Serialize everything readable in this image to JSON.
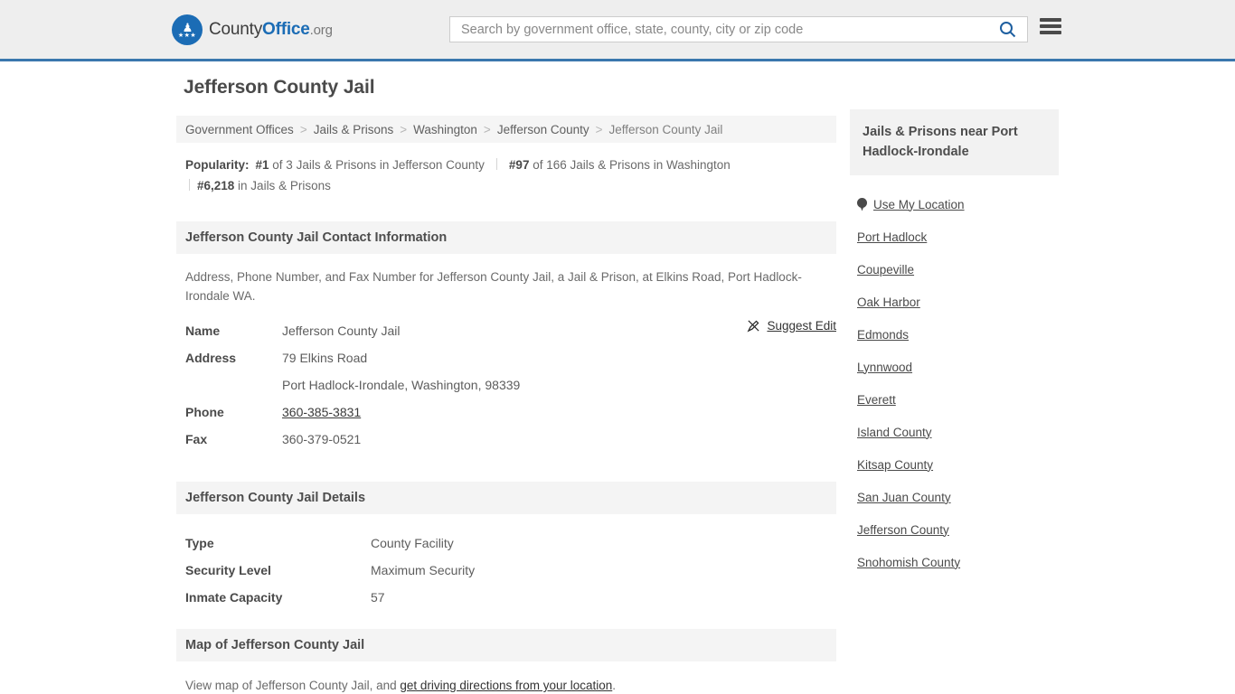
{
  "header": {
    "logo_text_county": "County",
    "logo_text_office": "Office",
    "logo_text_org": ".org",
    "search_placeholder": "Search by government office, state, county, city or zip code",
    "search_value": "",
    "accent_color": "#3a77ad",
    "logo_color": "#1b6cb5"
  },
  "page": {
    "title": "Jefferson County Jail"
  },
  "breadcrumb": {
    "items": [
      {
        "label": "Government Offices"
      },
      {
        "label": "Jails & Prisons"
      },
      {
        "label": "Washington"
      },
      {
        "label": "Jefferson County"
      },
      {
        "label": "Jefferson County Jail"
      }
    ],
    "separator": ">"
  },
  "popularity": {
    "label": "Popularity:",
    "items": [
      {
        "rank": "#1",
        "rest": " of 3 Jails & Prisons in Jefferson County"
      },
      {
        "rank": "#97",
        "rest": " of 166 Jails & Prisons in Washington"
      },
      {
        "rank": "#6,218",
        "rest": " in Jails & Prisons"
      }
    ]
  },
  "contact": {
    "section_title": "Jefferson County Jail Contact Information",
    "description": "Address, Phone Number, and Fax Number for Jefferson County Jail, a Jail & Prison, at Elkins Road, Port Hadlock-Irondale WA.",
    "suggest_edit_label": "Suggest Edit",
    "rows": [
      {
        "key": "Name",
        "value": "Jefferson County Jail"
      },
      {
        "key": "Address",
        "value": "79 Elkins Road"
      },
      {
        "key": "",
        "value": "Port Hadlock-Irondale, Washington, 98339"
      },
      {
        "key": "Phone",
        "value": "360-385-3831"
      },
      {
        "key": "Fax",
        "value": "360-379-0521"
      }
    ]
  },
  "details": {
    "section_title": "Jefferson County Jail Details",
    "rows": [
      {
        "key": "Type",
        "value": "County Facility"
      },
      {
        "key": "Security Level",
        "value": "Maximum Security"
      },
      {
        "key": "Inmate Capacity",
        "value": "57"
      }
    ]
  },
  "map": {
    "section_title": "Map of Jefferson County Jail",
    "desc_prefix": "View map of Jefferson County Jail, and ",
    "link_label": "get driving directions from your location",
    "desc_suffix": "."
  },
  "sidebar": {
    "heading": "Jails & Prisons near Port Hadlock-Irondale",
    "use_my_location": "Use My Location",
    "links": [
      {
        "label": "Port Hadlock"
      },
      {
        "label": "Coupeville"
      },
      {
        "label": "Oak Harbor"
      },
      {
        "label": "Edmonds"
      },
      {
        "label": "Lynnwood"
      },
      {
        "label": "Everett"
      },
      {
        "label": "Island County"
      },
      {
        "label": "Kitsap County"
      },
      {
        "label": "San Juan County"
      },
      {
        "label": "Jefferson County"
      },
      {
        "label": "Snohomish County"
      }
    ]
  }
}
